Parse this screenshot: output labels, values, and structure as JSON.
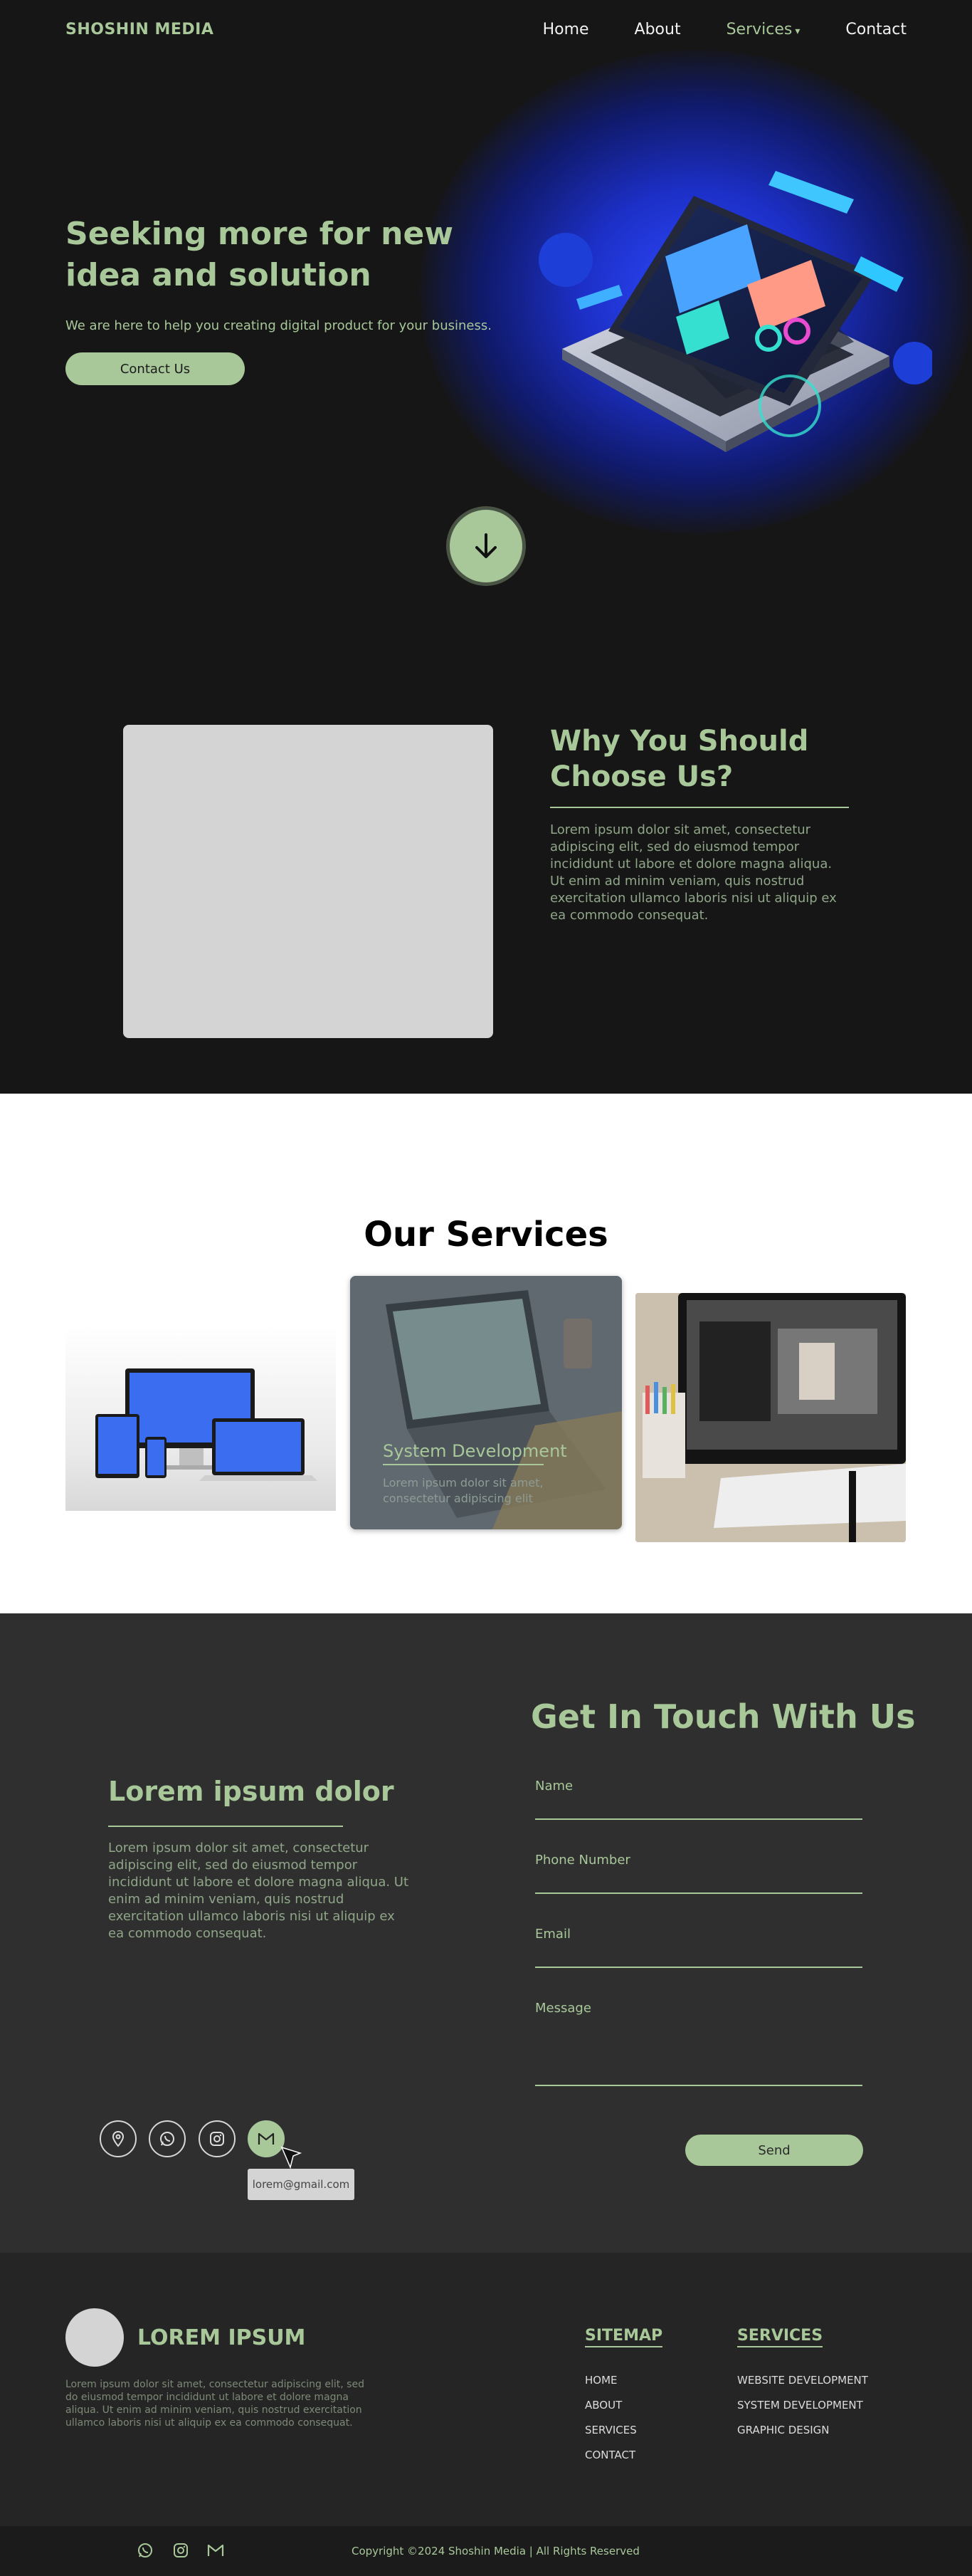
{
  "nav": {
    "brand": "SHOSHIN MEDIA",
    "links": [
      {
        "label": "Home"
      },
      {
        "label": "About"
      },
      {
        "label": "Services",
        "caret": "▾"
      },
      {
        "label": "Contact"
      }
    ]
  },
  "hero": {
    "title": "Seeking more for new idea and solution",
    "subtitle": "We are here to help you creating digital product for your business.",
    "cta_label": "Contact Us"
  },
  "why": {
    "title": "Why You Should Choose Us?",
    "text": "Lorem ipsum dolor sit amet, consectetur adipiscing elit, sed do eiusmod tempor incididunt ut labore et dolore magna aliqua. Ut enim ad minim veniam, quis nostrud exercitation ullamco laboris nisi ut aliquip ex ea commodo consequat."
  },
  "services": {
    "title": "Our Services",
    "featured": {
      "label": "System Development",
      "text": "Lorem ipsum dolor sit amet, consectetur adipiscing elit"
    }
  },
  "contact": {
    "left_title": "Lorem ipsum dolor",
    "left_text": "Lorem ipsum dolor sit amet, consectetur adipiscing elit, sed do eiusmod tempor incididunt ut labore et dolore magna aliqua. Ut enim ad minim veniam, quis nostrud exercitation ullamco laboris nisi ut aliquip ex ea commodo consequat.",
    "form_title": "Get In Touch With Us",
    "fields": {
      "name": "Name",
      "phone": "Phone Number",
      "email": "Email",
      "message": "Message"
    },
    "send_label": "Send",
    "social_icons": [
      "location-icon",
      "whatsapp-icon",
      "instagram-icon",
      "gmail-icon"
    ],
    "tooltip": "lorem@gmail.com"
  },
  "footer": {
    "brand": "LOREM IPSUM",
    "desc": "Lorem ipsum dolor sit amet, consectetur adipiscing elit, sed do eiusmod tempor incididunt ut labore et dolore magna aliqua. Ut enim ad minim veniam, quis nostrud exercitation ullamco laboris nisi ut aliquip ex ea commodo consequat.",
    "sitemap_title": "SITEMAP",
    "sitemap": [
      "HOME",
      "ABOUT",
      "SERVICES",
      "CONTACT"
    ],
    "services_title": "SERVICES",
    "services": [
      "WEBSITE DEVELOPMENT",
      "SYSTEM DEVELOPMENT",
      "GRAPHIC DESIGN"
    ],
    "copyright": "Copyright ©2024 Shoshin Media | All Rights Reserved"
  },
  "colors": {
    "accent": "#a8c89a",
    "hero_bg": "#161616",
    "contact_bg": "#2f2f2f",
    "footer_bg": "#252525"
  }
}
